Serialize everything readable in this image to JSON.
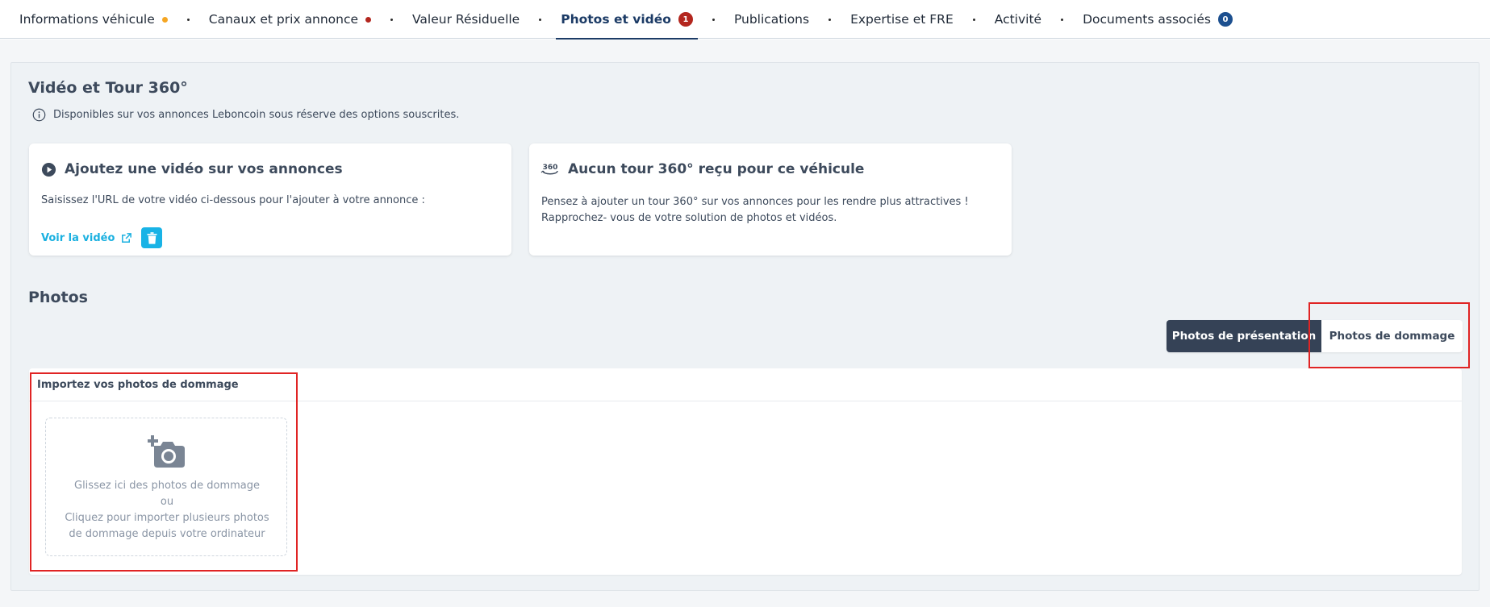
{
  "tabs": [
    {
      "label": "Informations véhicule",
      "indicator": "dot",
      "color": "#f5a623",
      "active": false
    },
    {
      "label": "Canaux et prix annonce",
      "indicator": "dot",
      "color": "#b3261e",
      "active": false
    },
    {
      "label": "Valeur Résiduelle",
      "indicator": null,
      "active": false
    },
    {
      "label": "Photos et vidéo",
      "indicator": "badge",
      "badge": "1",
      "color": "#b3261e",
      "active": true
    },
    {
      "label": "Publications",
      "indicator": null,
      "active": false
    },
    {
      "label": "Expertise et FRE",
      "indicator": null,
      "active": false
    },
    {
      "label": "Activité",
      "indicator": null,
      "active": false
    },
    {
      "label": "Documents associés",
      "indicator": "badge",
      "badge": "0",
      "color": "#1c4f8f",
      "active": false
    }
  ],
  "video_section": {
    "title": "Vidéo et Tour 360°",
    "info": "Disponibles sur vos annonces Leboncoin sous réserve des options souscrites.",
    "video_card": {
      "title": "Ajoutez une vidéo sur vos annonces",
      "text": "Saisissez l'URL de votre vidéo ci-dessous pour l'ajouter à votre annonce :",
      "link": "Voir la vidéo"
    },
    "tour_card": {
      "icon_label": "360",
      "title": "Aucun tour 360° reçu pour ce véhicule",
      "line1": "Pensez à ajouter un tour 360° sur vos annonces pour les rendre plus attractives !",
      "line2": "Rapprochez- vous de votre solution de photos et vidéos."
    }
  },
  "photos_section": {
    "title": "Photos",
    "toggle": {
      "presentation": "Photos de présentation",
      "damage": "Photos de dommage",
      "selected": "damage"
    },
    "upload": {
      "title": "Importez vos photos de dommage",
      "line1": "Glissez ici des photos de dommage",
      "line2": "ou",
      "line3": "Cliquez pour importer plusieurs photos",
      "line4": "de dommage depuis votre ordinateur"
    }
  },
  "colors": {
    "accent": "#1c3b66",
    "link": "#1ab0e0",
    "dark_button": "#354256",
    "highlight": "#e02424"
  }
}
